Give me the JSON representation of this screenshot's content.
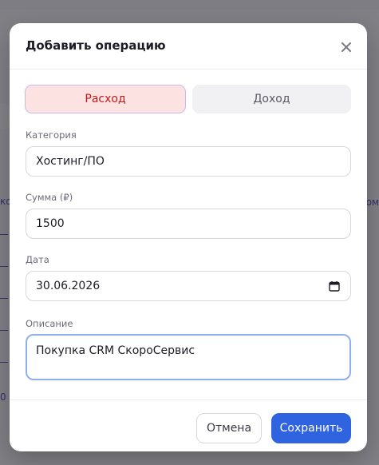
{
  "background": {
    "left_fragments": [
      "ко",
      "0 к"
    ],
    "right_fragments": [
      "ом"
    ]
  },
  "modal": {
    "title": "Добавить операцию",
    "close_icon": "close-icon"
  },
  "type_toggle": {
    "expense_label": "Расход",
    "income_label": "Доход",
    "selected": "expense"
  },
  "form": {
    "category": {
      "label": "Категория",
      "value": "Хостинг/ПО"
    },
    "amount": {
      "label": "Сумма (₽)",
      "value": "1500"
    },
    "date": {
      "label": "Дата",
      "value": "30.06.2026",
      "icon": "calendar-icon"
    },
    "description": {
      "label": "Описание",
      "value": "Покупка CRM СкороСервис"
    }
  },
  "footer": {
    "cancel_label": "Отмена",
    "save_label": "Сохранить"
  },
  "colors": {
    "accent": "#2f63e0",
    "expense_bg": "#fde2e2",
    "expense_text": "#b91c1c"
  }
}
